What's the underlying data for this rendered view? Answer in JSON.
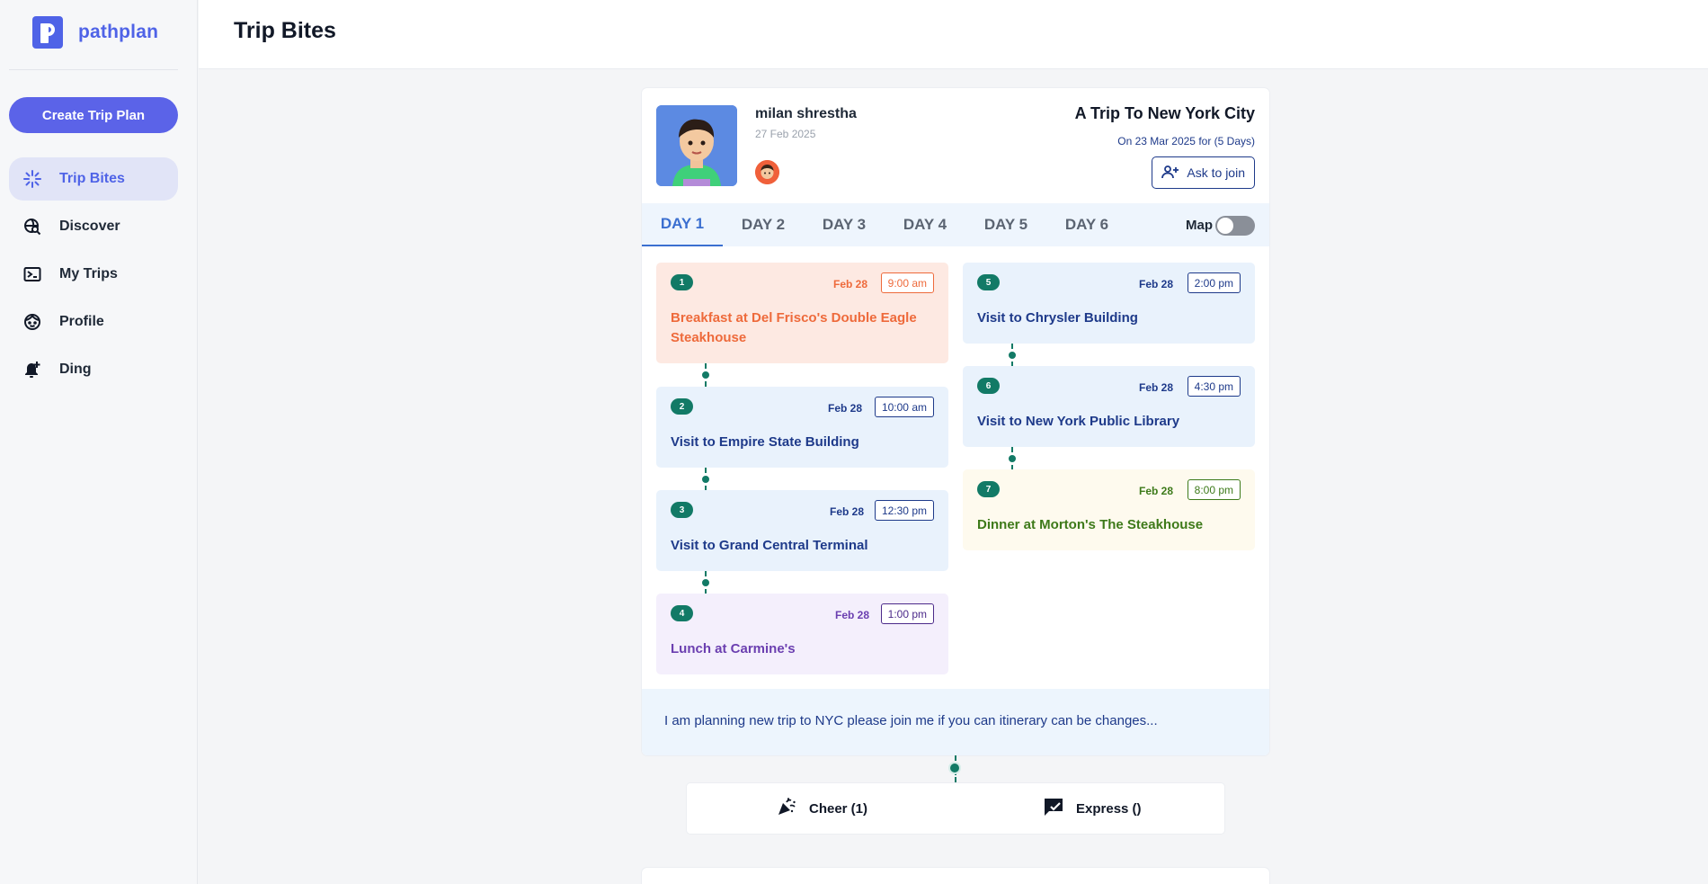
{
  "brand": {
    "name": "pathplan"
  },
  "sidebar": {
    "create_label": "Create Trip Plan",
    "items": [
      {
        "label": "Trip Bites",
        "icon": "sparkle-icon"
      },
      {
        "label": "Discover",
        "icon": "globe-search-icon"
      },
      {
        "label": "My Trips",
        "icon": "ticket-icon"
      },
      {
        "label": "Profile",
        "icon": "face-icon"
      },
      {
        "label": "Ding",
        "icon": "bell-plus-icon"
      }
    ]
  },
  "header": {
    "title": "Trip Bites"
  },
  "post": {
    "user_name": "milan shrestha",
    "posted_date": "27 Feb 2025",
    "trip_title": "A Trip To New York City",
    "trip_when": "On 23 Mar 2025 for (5 Days)",
    "join_label": "Ask to join",
    "map_label": "Map",
    "tabs": [
      "DAY 1",
      "DAY 2",
      "DAY 3",
      "DAY 4",
      "DAY 5",
      "DAY 6"
    ],
    "activities": [
      {
        "num": "1",
        "date": "Feb 28",
        "time": "9:00 am",
        "title": "Breakfast at Del Frisco's Double Eagle Steakhouse",
        "kind": "breakfast"
      },
      {
        "num": "2",
        "date": "Feb 28",
        "time": "10:00 am",
        "title": "Visit to Empire State Building",
        "kind": "visit"
      },
      {
        "num": "3",
        "date": "Feb 28",
        "time": "12:30 pm",
        "title": "Visit to Grand Central Terminal",
        "kind": "visit"
      },
      {
        "num": "4",
        "date": "Feb 28",
        "time": "1:00 pm",
        "title": "Lunch at Carmine's",
        "kind": "lunch"
      },
      {
        "num": "5",
        "date": "Feb 28",
        "time": "2:00 pm",
        "title": "Visit to Chrysler Building",
        "kind": "visit"
      },
      {
        "num": "6",
        "date": "Feb 28",
        "time": "4:30 pm",
        "title": "Visit to New York Public Library",
        "kind": "visit"
      },
      {
        "num": "7",
        "date": "Feb 28",
        "time": "8:00 pm",
        "title": "Dinner at Morton's The Steakhouse",
        "kind": "dinner"
      }
    ],
    "note": "I am planning new trip to NYC please join me if you can itinerary can be changes...",
    "cheer_label": "Cheer (1)",
    "express_label": "Express ()"
  },
  "colors": {
    "accent": "#4f63e7",
    "teal": "#127a66",
    "navy": "#1e3a8a",
    "orange": "#ee6a3b"
  }
}
